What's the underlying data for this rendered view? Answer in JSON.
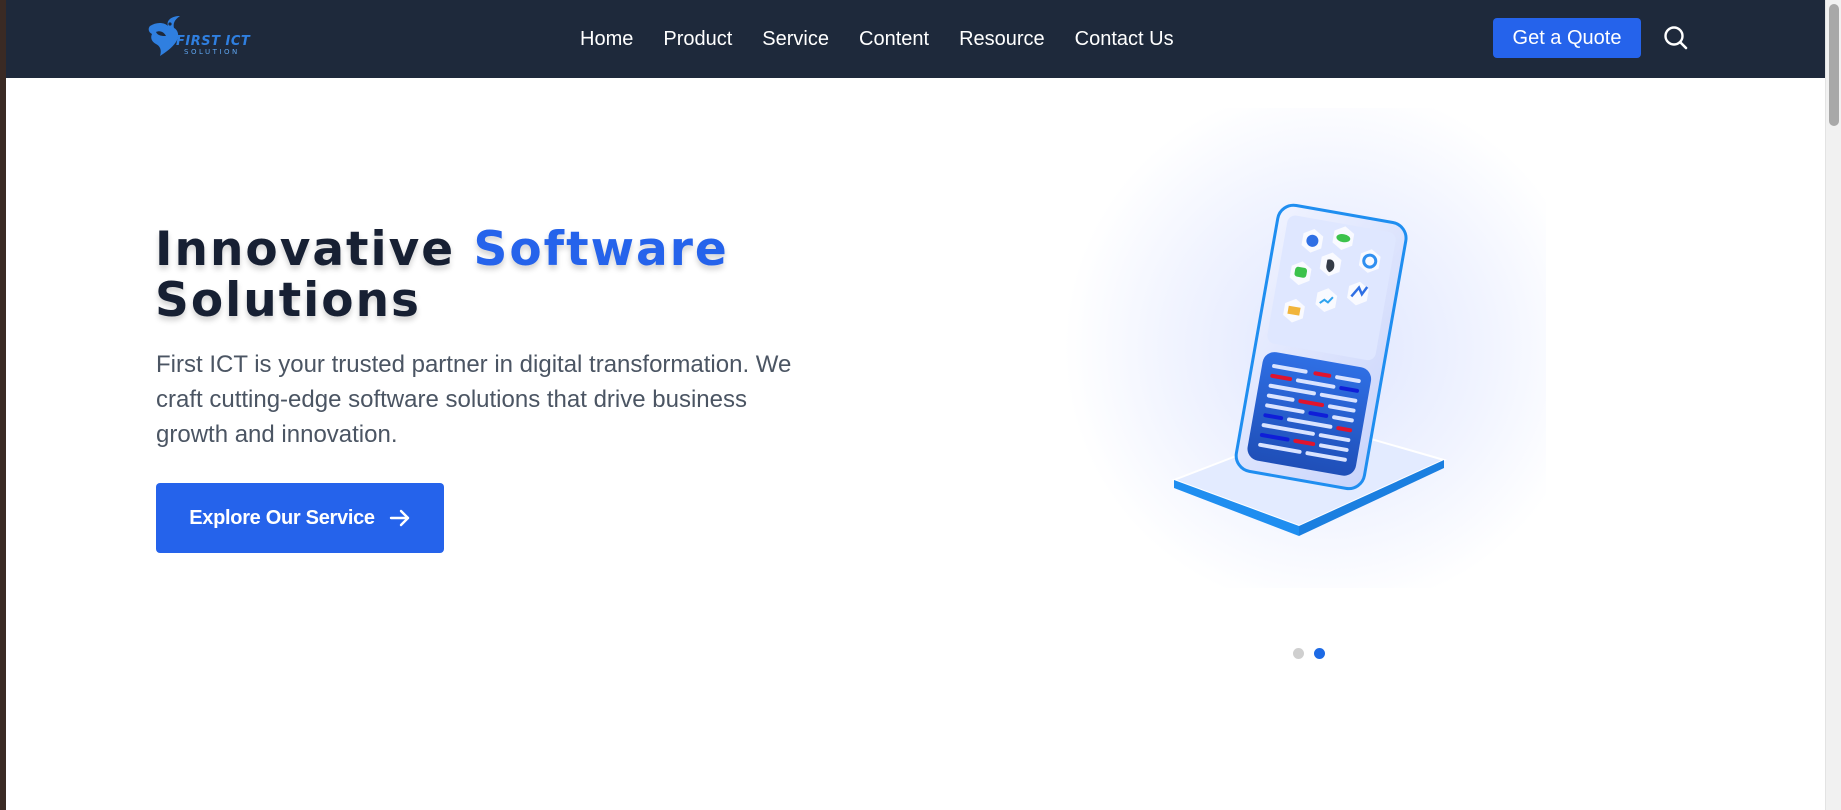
{
  "brand": {
    "name": "FIRST ICT",
    "tagline": "SOLUTION"
  },
  "nav": {
    "links": [
      "Home",
      "Product",
      "Service",
      "Content",
      "Resource",
      "Contact Us"
    ],
    "quote_label": "Get a Quote",
    "search_icon": "search-icon"
  },
  "hero": {
    "title_part1": "Innovative",
    "title_accent": "Software",
    "title_part2": "Solutions",
    "description": "First ICT is your trusted partner in digital transformation. We craft cutting-edge software solutions that drive business growth and innovation.",
    "cta_label": "Explore Our Service",
    "cta_icon": "arrow-right-icon"
  },
  "carousel": {
    "slide_count": 2,
    "active_index": 1
  },
  "colors": {
    "nav_bg": "#1e293b",
    "accent": "#2563eb",
    "heading": "#172033",
    "body_text": "#4b5563"
  }
}
